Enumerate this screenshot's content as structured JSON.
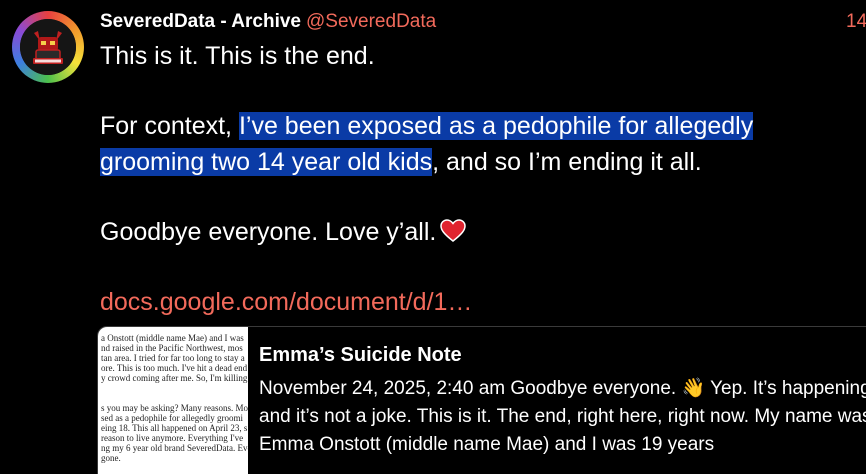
{
  "post": {
    "display_name": "SeveredData - Archive",
    "handle": "@SeveredData",
    "timestamp": "14",
    "line1": "This is it. This is the end.",
    "line2_prefix": "For context, ",
    "line2_highlight": "I’ve been exposed as a pedophile for allegedly",
    "line3_highlight": "grooming two 14 year old kids",
    "line3_suffix": ", and so I’m ending it all.",
    "line4": "Goodbye everyone. Love y’all.",
    "link": "docs.google.com/document/d/1…"
  },
  "card": {
    "title": "Emma’s Suicide Note",
    "description": "November 24, 2025, 2:40 am Goodbye everyone. 👋 Yep. It’s happening, and it’s not a joke. This is it. The end, right here, right now. My name was Emma Onstott (middle name Mae) and I was 19 years",
    "thumb_lines": [
      "a Onstott (middle name Mae) and I was",
      "nd raised in the Pacific Northwest, mos",
      "tan area. I tried for far too long to stay a",
      "ore. This is too much. I've hit a dead end",
      "y crowd coming after me. So, I'm killing",
      "s you may be asking? Many reasons. Mo",
      "sed as a pedophile for allegedly groomi",
      "eing 18. This all happened on April 23, s",
      "reason to live anymore. Everything I've",
      "ng my 6 year old brand SeveredData. Eve",
      "gone."
    ]
  },
  "colors": {
    "background": "#000000",
    "accent": "#f26a5b",
    "highlight": "#0a3ba6",
    "heart": "#e0242f"
  },
  "icons": {
    "avatar": "logo-avatar",
    "heart": "red-heart-emoji"
  }
}
